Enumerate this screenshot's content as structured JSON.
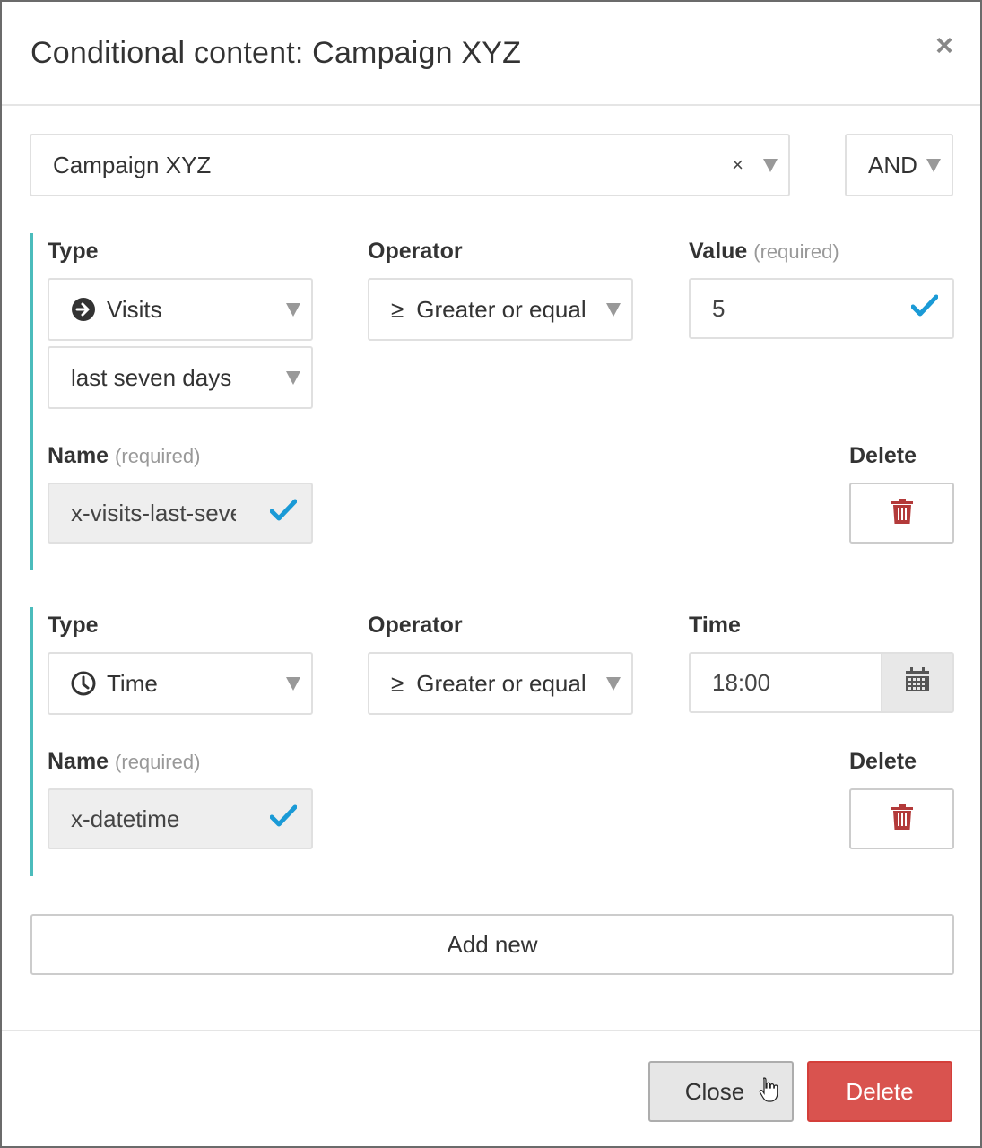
{
  "dialog": {
    "title": "Conditional content: Campaign XYZ",
    "close_icon": "×"
  },
  "campaign_select": {
    "value": "Campaign XYZ",
    "clear_icon": "×"
  },
  "logic_select": {
    "value": "AND"
  },
  "conditions": [
    {
      "type_label": "Type",
      "type_value": "Visits",
      "type_icon": "arrow-circle-right-icon",
      "period_value": "last seven days",
      "operator_label": "Operator",
      "operator_symbol": "≥",
      "operator_value": "Greater or equal",
      "value_label": "Value",
      "value_required": "(required)",
      "value": "5",
      "name_label": "Name",
      "name_required": "(required)",
      "name_value": "x-visits-last-seven-days",
      "delete_label": "Delete"
    },
    {
      "type_label": "Type",
      "type_value": "Time",
      "type_icon": "clock-icon",
      "operator_label": "Operator",
      "operator_symbol": "≥",
      "operator_value": "Greater or equal",
      "time_label": "Time",
      "time_value": "18:00",
      "name_label": "Name",
      "name_required": "(required)",
      "name_value": "x-datetime",
      "delete_label": "Delete"
    }
  ],
  "add_new_label": "Add new",
  "footer": {
    "close_label": "Close",
    "delete_label": "Delete"
  },
  "colors": {
    "accent_teal": "#4bbcbc",
    "check_blue": "#1a9ad6",
    "danger_red": "#d9534f",
    "trash_red": "#b33a3a"
  }
}
